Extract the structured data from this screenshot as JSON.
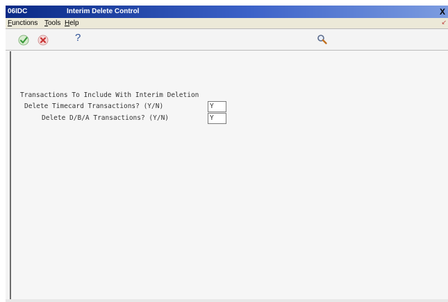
{
  "window": {
    "program_id": "06IDC",
    "title": "Interim Delete Control",
    "close_label": "X"
  },
  "menu": {
    "items": [
      {
        "mnemonic": "F",
        "rest": "unctions"
      },
      {
        "mnemonic": "T",
        "rest": "ools"
      },
      {
        "mnemonic": "H",
        "rest": "elp"
      }
    ]
  },
  "toolbar": {
    "icons": [
      "ok-check-icon",
      "cancel-x-icon",
      "help-question-icon",
      "search-magnifier-icon"
    ],
    "help_label": "?",
    "colors": {
      "ok": "#3a9a3a",
      "cancel": "#c83232",
      "help": "#2b4f95"
    }
  },
  "form": {
    "section_heading": "Transactions To Include With Interim Deletion",
    "fields": [
      {
        "label": "Delete Timecard Transactions? (Y/N)",
        "value": "Y"
      },
      {
        "label": "Delete D/B/A Transactions? (Y/N)",
        "value": "Y"
      }
    ]
  },
  "colors": {
    "title_bar_start": "#0a2a86",
    "title_bar_end": "#7c9ce0",
    "background": "#f4f4f4"
  }
}
